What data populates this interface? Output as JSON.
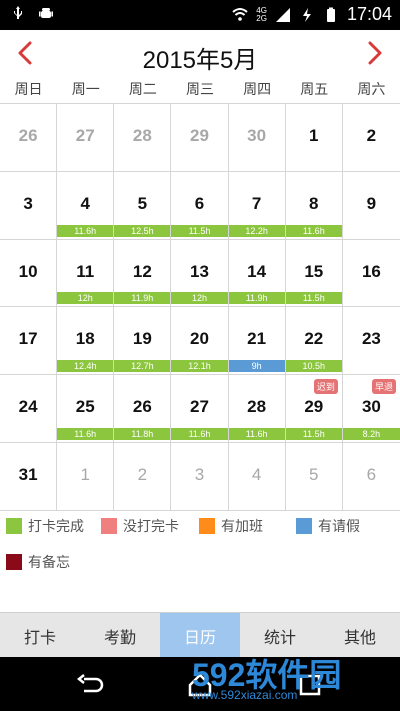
{
  "status_bar": {
    "time": "17:04",
    "icons": [
      "usb-icon",
      "android-icon",
      "wifi-icon",
      "signal-icon",
      "charging-bolt-icon",
      "battery-icon"
    ],
    "network_labels": [
      "4G",
      "2G"
    ]
  },
  "header": {
    "title": "2015年5月",
    "prev_icon": "chevron-left-icon",
    "next_icon": "chevron-right-icon",
    "accent_color": "#d83a3a"
  },
  "weekdays": [
    "周日",
    "周一",
    "周二",
    "周三",
    "周四",
    "周五",
    "周六"
  ],
  "calendar": {
    "cells": [
      {
        "day": "26",
        "muted": true
      },
      {
        "day": "27",
        "muted": true
      },
      {
        "day": "28",
        "muted": true
      },
      {
        "day": "29",
        "muted": true
      },
      {
        "day": "30",
        "muted": true
      },
      {
        "day": "1"
      },
      {
        "day": "2"
      },
      {
        "day": "3"
      },
      {
        "day": "4",
        "bar": "11.6h",
        "bar_color": "green"
      },
      {
        "day": "5",
        "bar": "12.5h",
        "bar_color": "green"
      },
      {
        "day": "6",
        "bar": "11.5h",
        "bar_color": "green"
      },
      {
        "day": "7",
        "bar": "12.2h",
        "bar_color": "green"
      },
      {
        "day": "8",
        "bar": "11.6h",
        "bar_color": "green"
      },
      {
        "day": "9"
      },
      {
        "day": "10"
      },
      {
        "day": "11",
        "bar": "12h",
        "bar_color": "green"
      },
      {
        "day": "12",
        "bar": "11.9h",
        "bar_color": "green"
      },
      {
        "day": "13",
        "bar": "12h",
        "bar_color": "green"
      },
      {
        "day": "14",
        "bar": "11.9h",
        "bar_color": "green"
      },
      {
        "day": "15",
        "bar": "11.5h",
        "bar_color": "green"
      },
      {
        "day": "16"
      },
      {
        "day": "17"
      },
      {
        "day": "18",
        "bar": "12.4h",
        "bar_color": "green"
      },
      {
        "day": "19",
        "bar": "12.7h",
        "bar_color": "green"
      },
      {
        "day": "20",
        "bar": "12.1h",
        "bar_color": "green"
      },
      {
        "day": "21",
        "bar": "9h",
        "bar_color": "blue"
      },
      {
        "day": "22",
        "bar": "10.5h",
        "bar_color": "green"
      },
      {
        "day": "23"
      },
      {
        "day": "24"
      },
      {
        "day": "25",
        "bar": "11.6h",
        "bar_color": "green"
      },
      {
        "day": "26",
        "bar": "11.8h",
        "bar_color": "green"
      },
      {
        "day": "27",
        "bar": "11.6h",
        "bar_color": "green"
      },
      {
        "day": "28",
        "bar": "11.6h",
        "bar_color": "green"
      },
      {
        "day": "29",
        "bar": "11.5h",
        "bar_color": "green",
        "badge": "迟到"
      },
      {
        "day": "30",
        "bar": "8.2h",
        "bar_color": "green",
        "badge": "早退"
      },
      {
        "day": "31"
      },
      {
        "day": "1",
        "muted": true,
        "bottom": true
      },
      {
        "day": "2",
        "muted": true,
        "bottom": true
      },
      {
        "day": "3",
        "muted": true,
        "bottom": true
      },
      {
        "day": "4",
        "muted": true,
        "bottom": true
      },
      {
        "day": "5",
        "muted": true,
        "bottom": true
      },
      {
        "day": "6",
        "muted": true,
        "bottom": true
      }
    ]
  },
  "legend": [
    {
      "label": "打卡完成",
      "color": "#8cc63f"
    },
    {
      "label": "没打完卡",
      "color": "#f08080"
    },
    {
      "label": "有加班",
      "color": "#ff8c1a"
    },
    {
      "label": "有请假",
      "color": "#5b9bd5"
    },
    {
      "label": "有备忘",
      "color": "#8b0a1a"
    }
  ],
  "tabs": [
    {
      "label": "打卡"
    },
    {
      "label": "考勤"
    },
    {
      "label": "日历",
      "active": true
    },
    {
      "label": "统计"
    },
    {
      "label": "其他"
    }
  ],
  "navbar": {
    "icons": [
      "back-icon",
      "home-icon",
      "recent-apps-icon"
    ]
  },
  "watermark": {
    "big_text": "592软件园",
    "small_text": "www.592xiazai.com"
  }
}
